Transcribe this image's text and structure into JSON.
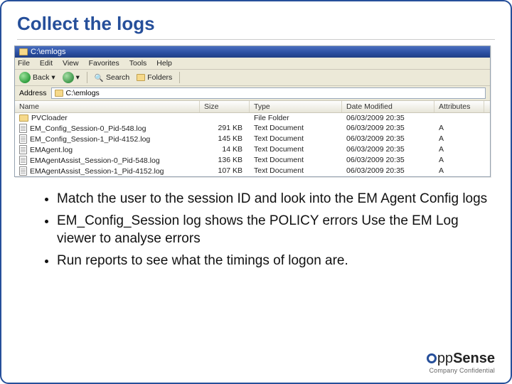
{
  "title": "Collect the logs",
  "explorer": {
    "windowTitle": "C:\\emlogs",
    "menus": [
      "File",
      "Edit",
      "View",
      "Favorites",
      "Tools",
      "Help"
    ],
    "toolbar": {
      "back": "Back",
      "search": "Search",
      "folders": "Folders"
    },
    "addressLabel": "Address",
    "addressValue": "C:\\emlogs",
    "columns": [
      "Name",
      "Size",
      "Type",
      "Date Modified",
      "Attributes"
    ],
    "rows": [
      {
        "name": "PVCloader",
        "icon": "folder",
        "size": "",
        "type": "File Folder",
        "date": "06/03/2009 20:35",
        "attr": ""
      },
      {
        "name": "EM_Config_Session-0_Pid-548.log",
        "icon": "file",
        "size": "291 KB",
        "type": "Text Document",
        "date": "06/03/2009 20:35",
        "attr": "A"
      },
      {
        "name": "EM_Config_Session-1_Pid-4152.log",
        "icon": "file",
        "size": "145 KB",
        "type": "Text Document",
        "date": "06/03/2009 20:35",
        "attr": "A"
      },
      {
        "name": "EMAgent.log",
        "icon": "file",
        "size": "14 KB",
        "type": "Text Document",
        "date": "06/03/2009 20:35",
        "attr": "A"
      },
      {
        "name": "EMAgentAssist_Session-0_Pid-548.log",
        "icon": "file",
        "size": "136 KB",
        "type": "Text Document",
        "date": "06/03/2009 20:35",
        "attr": "A"
      },
      {
        "name": "EMAgentAssist_Session-1_Pid-4152.log",
        "icon": "file",
        "size": "107 KB",
        "type": "Text Document",
        "date": "06/03/2009 20:35",
        "attr": "A"
      }
    ]
  },
  "bullets": [
    "Match the user to the session ID and look into the EM Agent Config logs",
    "EM_Config_Session log shows the POLICY errors Use the EM Log viewer to analyse errors",
    "Run reports to see what the timings of logon are."
  ],
  "brandPrefix": "pp",
  "brandSuffix": "Sense",
  "confidential": "Company Confidential"
}
